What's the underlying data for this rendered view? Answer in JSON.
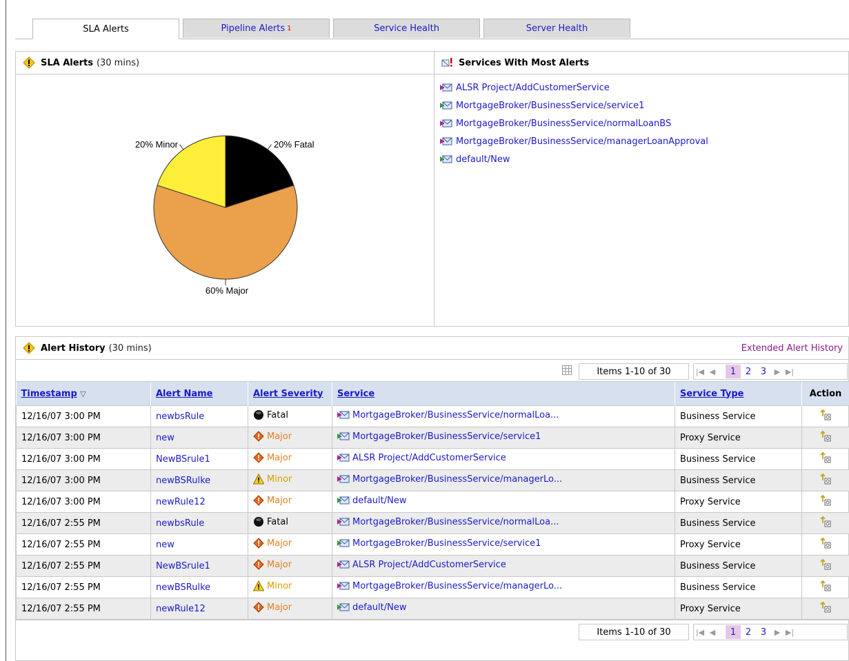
{
  "tabs": [
    {
      "label": "SLA Alerts",
      "active": true,
      "badge": ""
    },
    {
      "label": "Pipeline Alerts",
      "active": false,
      "badge": "1"
    },
    {
      "label": "Service Health",
      "active": false,
      "badge": ""
    },
    {
      "label": "Server Health",
      "active": false,
      "badge": ""
    }
  ],
  "sla_panel": {
    "title": "SLA Alerts",
    "subtitle": "(30 mins)"
  },
  "services_panel": {
    "title": "Services With Most Alerts",
    "items": [
      {
        "label": "ALSR Project/AddCustomerService",
        "icon": "business-service-icon"
      },
      {
        "label": "MortgageBroker/BusinessService/service1",
        "icon": "proxy-service-icon"
      },
      {
        "label": "MortgageBroker/BusinessService/normalLoanBS",
        "icon": "business-service-icon"
      },
      {
        "label": "MortgageBroker/BusinessService/managerLoanApproval",
        "icon": "business-service-icon"
      },
      {
        "label": "default/New",
        "icon": "proxy-service-icon"
      }
    ]
  },
  "chart_data": {
    "type": "pie",
    "slices": [
      {
        "label": "20% Fatal",
        "value": 20,
        "color": "#000000"
      },
      {
        "label": "60% Major",
        "value": 60,
        "color": "#eba04b"
      },
      {
        "label": "20% Minor",
        "value": 20,
        "color": "#fdee3a"
      }
    ]
  },
  "history": {
    "title": "Alert History",
    "subtitle": "(30 mins)",
    "extended_link": "Extended Alert History",
    "items_label": "Items 1-10 of 30",
    "pages": [
      "1",
      "2",
      "3"
    ],
    "current_page": "1",
    "columns": {
      "timestamp": "Timestamp",
      "alert_name": "Alert Name",
      "severity": "Alert Severity",
      "service": "Service",
      "service_type": "Service Type",
      "action": "Action"
    },
    "rows": [
      {
        "timestamp": "12/16/07 3:00 PM",
        "name": "newbsRule",
        "severity": "Fatal",
        "service": "MortgageBroker/BusinessService/normalLoa...",
        "stype": "Business Service",
        "sicon": "business"
      },
      {
        "timestamp": "12/16/07 3:00 PM",
        "name": "new",
        "severity": "Major",
        "service": "MortgageBroker/BusinessService/service1",
        "stype": "Proxy Service",
        "sicon": "proxy"
      },
      {
        "timestamp": "12/16/07 3:00 PM",
        "name": "NewBSrule1",
        "severity": "Major",
        "service": "ALSR Project/AddCustomerService",
        "stype": "Business Service",
        "sicon": "business"
      },
      {
        "timestamp": "12/16/07 3:00 PM",
        "name": "newBSRulke",
        "severity": "Minor",
        "service": "MortgageBroker/BusinessService/managerLo...",
        "stype": "Business Service",
        "sicon": "business"
      },
      {
        "timestamp": "12/16/07 3:00 PM",
        "name": "newRule12",
        "severity": "Major",
        "service": "default/New",
        "stype": "Proxy Service",
        "sicon": "proxy"
      },
      {
        "timestamp": "12/16/07 2:55 PM",
        "name": "newbsRule",
        "severity": "Fatal",
        "service": "MortgageBroker/BusinessService/normalLoa...",
        "stype": "Business Service",
        "sicon": "business"
      },
      {
        "timestamp": "12/16/07 2:55 PM",
        "name": "new",
        "severity": "Major",
        "service": "MortgageBroker/BusinessService/service1",
        "stype": "Proxy Service",
        "sicon": "proxy"
      },
      {
        "timestamp": "12/16/07 2:55 PM",
        "name": "NewBSrule1",
        "severity": "Major",
        "service": "ALSR Project/AddCustomerService",
        "stype": "Business Service",
        "sicon": "business"
      },
      {
        "timestamp": "12/16/07 2:55 PM",
        "name": "newBSRulke",
        "severity": "Minor",
        "service": "MortgageBroker/BusinessService/managerLo...",
        "stype": "Business Service",
        "sicon": "business"
      },
      {
        "timestamp": "12/16/07 2:55 PM",
        "name": "newRule12",
        "severity": "Major",
        "service": "default/New",
        "stype": "Proxy Service",
        "sicon": "proxy"
      }
    ]
  }
}
